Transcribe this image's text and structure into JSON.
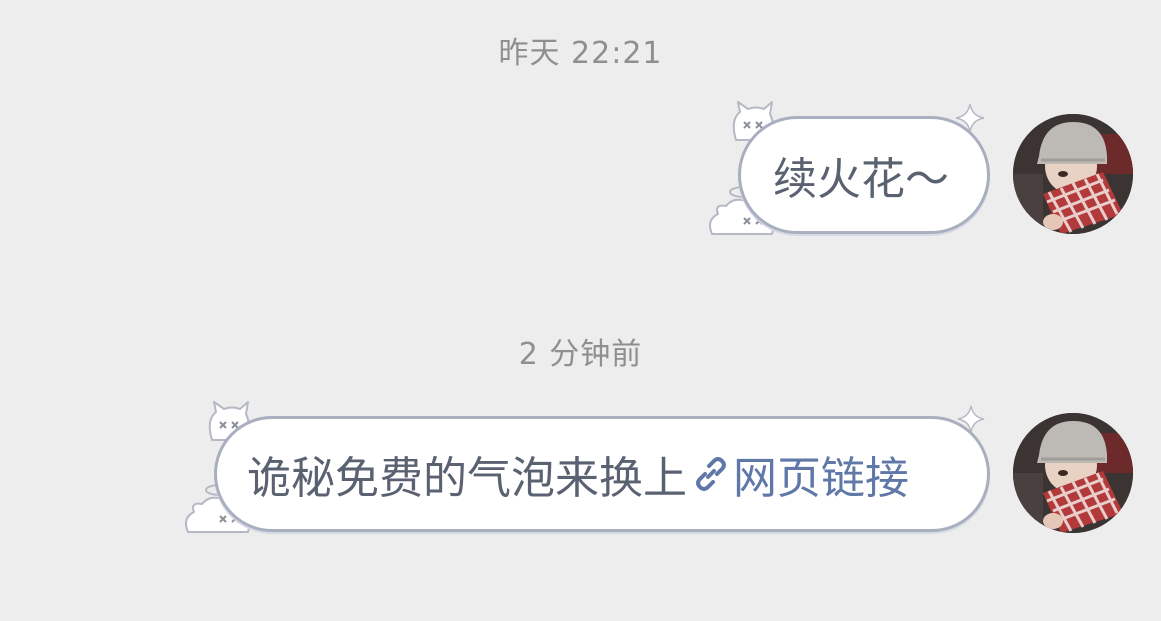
{
  "timestamps": {
    "first": "昨天 22:21",
    "second": "2 分钟前"
  },
  "messages": [
    {
      "text": "续火花～"
    },
    {
      "text": "诡秘免费的气泡来换上",
      "link_text": "网页链接"
    }
  ],
  "colors": {
    "background": "#ededed",
    "bubble_fill": "#ffffff",
    "bubble_border": "#a9afbf",
    "text": "#5a6272",
    "link": "#5f78a8",
    "timestamp": "#8f8f8f"
  },
  "icons": {
    "link": "link-icon",
    "decoration_top": "ghost-cat-sticker-icon",
    "decoration_bottom": "blob-halo-sticker-icon",
    "sparkle": "sparkle-icon"
  }
}
